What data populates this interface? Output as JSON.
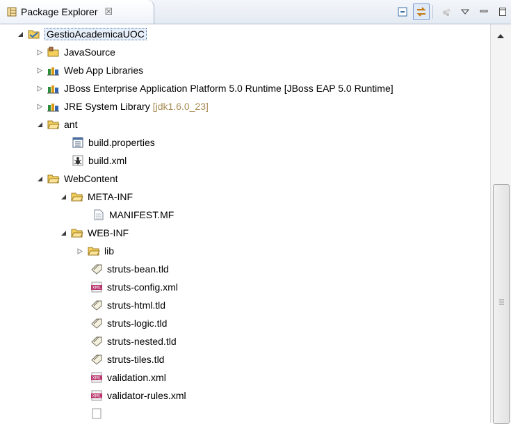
{
  "view": {
    "title": "Package Explorer",
    "close_glyph": "☒",
    "toolbar_icons": [
      "collapse-all-icon",
      "link-with-editor-icon",
      "focus-icon",
      "view-menu-icon",
      "minimize-icon",
      "maximize-icon"
    ]
  },
  "tree": {
    "root": {
      "label": "GestioAcademicaUOC",
      "icon": "project-icon"
    },
    "javasource": {
      "label": "JavaSource",
      "icon": "source-folder-icon"
    },
    "webapplib": {
      "label": "Web App Libraries",
      "icon": "library-icon"
    },
    "jboss": {
      "label": "JBoss Enterprise Application Platform 5.0 Runtime [JBoss EAP 5.0 Runtime]",
      "icon": "library-icon"
    },
    "jre": {
      "label": "JRE System Library",
      "decoration": "[jdk1.6.0_23]",
      "icon": "library-icon"
    },
    "ant": {
      "label": "ant",
      "icon": "folder-icon"
    },
    "buildprops": {
      "label": "build.properties",
      "icon": "properties-file-icon"
    },
    "buildxml": {
      "label": "build.xml",
      "icon": "ant-file-icon"
    },
    "webcontent": {
      "label": "WebContent",
      "icon": "folder-icon"
    },
    "metainf": {
      "label": "META-INF",
      "icon": "folder-icon"
    },
    "manifest": {
      "label": "MANIFEST.MF",
      "icon": "text-file-icon"
    },
    "webinf": {
      "label": "WEB-INF",
      "icon": "folder-icon"
    },
    "lib": {
      "label": "lib",
      "icon": "folder-icon"
    },
    "bean": {
      "label": "struts-bean.tld",
      "icon": "tld-file-icon"
    },
    "config": {
      "label": "struts-config.xml",
      "icon": "xml-file-icon"
    },
    "html": {
      "label": "struts-html.tld",
      "icon": "tld-file-icon"
    },
    "logic": {
      "label": "struts-logic.tld",
      "icon": "tld-file-icon"
    },
    "nested": {
      "label": "struts-nested.tld",
      "icon": "tld-file-icon"
    },
    "tiles": {
      "label": "struts-tiles.tld",
      "icon": "tld-file-icon"
    },
    "validation": {
      "label": "validation.xml",
      "icon": "xml-file-icon"
    },
    "validator": {
      "label": "validator-rules.xml",
      "icon": "xml-file-icon"
    }
  },
  "colors": {
    "decoration": "#a98a54",
    "selection_bg": "#e6effa",
    "folder": "#f3cf5c"
  }
}
